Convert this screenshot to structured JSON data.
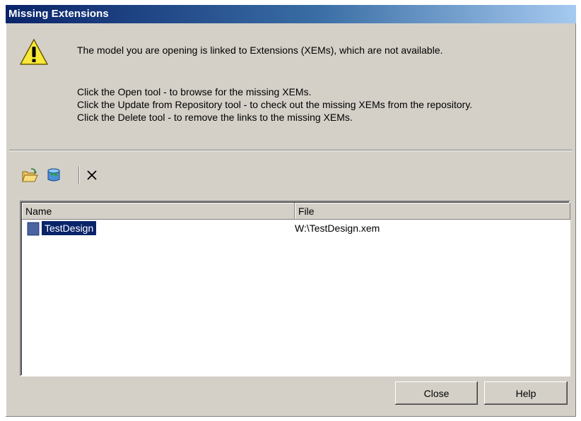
{
  "window": {
    "title": "Missing Extensions"
  },
  "message": {
    "main": "The model you are opening is linked to Extensions (XEMs), which are not available.",
    "lines": [
      "Click the Open tool - to browse for the missing XEMs.",
      "Click the Update from Repository tool - to check out the missing XEMs from the repository.",
      "Click the Delete tool - to remove the links to the missing XEMs."
    ]
  },
  "toolbar": {
    "tools": [
      {
        "name": "Open",
        "icon": "open-folder-icon"
      },
      {
        "name": "Update from Repository",
        "icon": "repository-update-icon"
      },
      {
        "name": "Delete",
        "icon": "delete-x-icon"
      }
    ]
  },
  "list": {
    "columns": [
      "Name",
      "File"
    ],
    "rows": [
      {
        "name": "TestDesign",
        "file": "W:\\TestDesign.xem",
        "selected": true
      }
    ]
  },
  "buttons": {
    "close": "Close",
    "help": "Help"
  },
  "colors": {
    "titlebar_start": "#0a246a",
    "titlebar_end": "#a6caf0",
    "selection": "#0a246a",
    "dialog_bg": "#d4d0c8"
  }
}
